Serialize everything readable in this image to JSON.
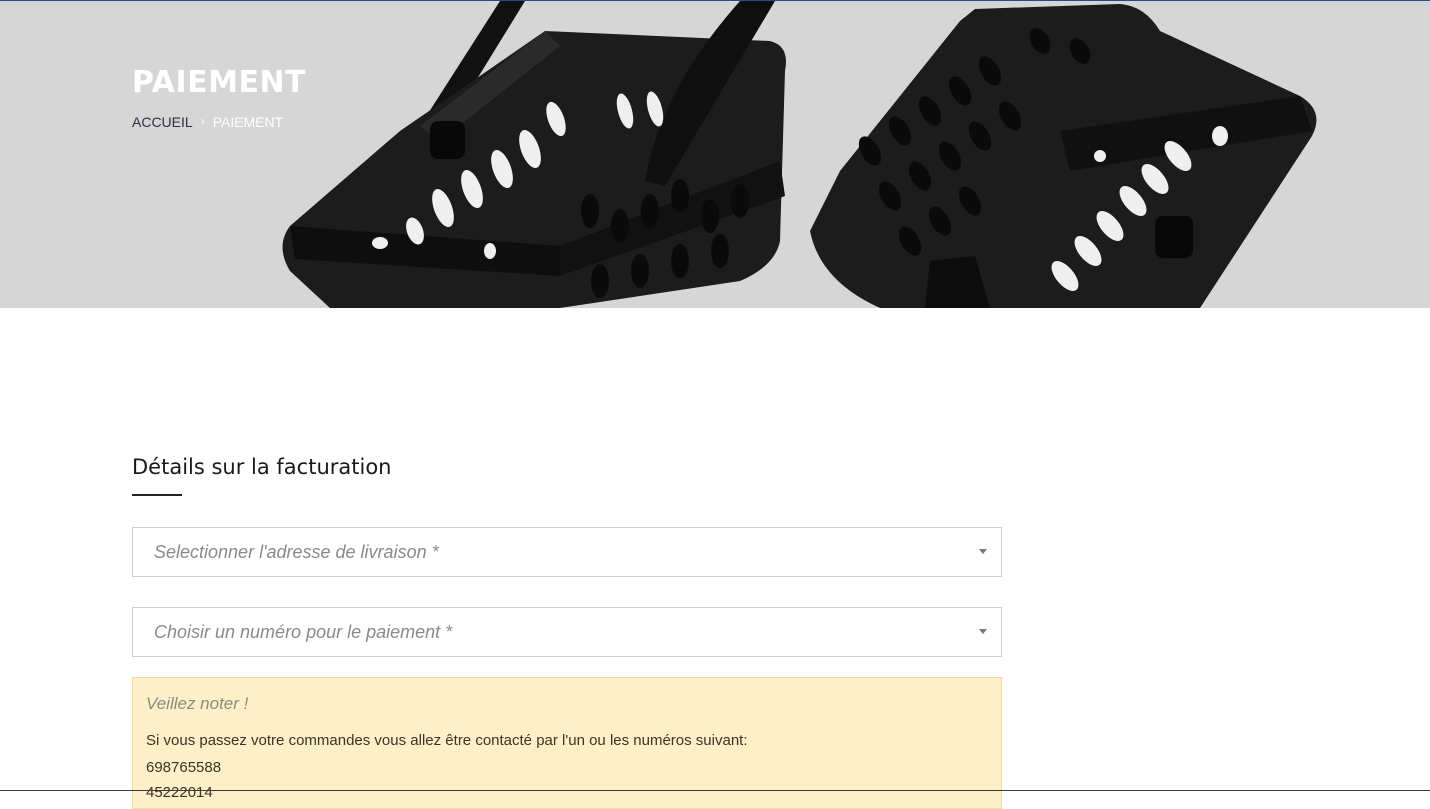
{
  "hero": {
    "title": "PAIEMENT",
    "breadcrumb": {
      "home": "ACCUEIL",
      "separator": "›",
      "current": "PAIEMENT"
    }
  },
  "billing": {
    "title": "Détails sur la facturation",
    "address_select": {
      "placeholder": "Selectionner l'adresse de livraison *"
    },
    "phone_select": {
      "placeholder": "Choisir un numéro pour le paiement *"
    }
  },
  "notice": {
    "title": "Veillez noter !",
    "text": "Si vous passez votre commandes vous allez être contacté par l'un ou les numéros suivant:",
    "phones": [
      "698765588",
      "45222014"
    ]
  },
  "colors": {
    "hero_bg": "#d6d6d6",
    "notice_bg": "#fdf0c9",
    "breadcrumb_home": "#2b2f48"
  }
}
